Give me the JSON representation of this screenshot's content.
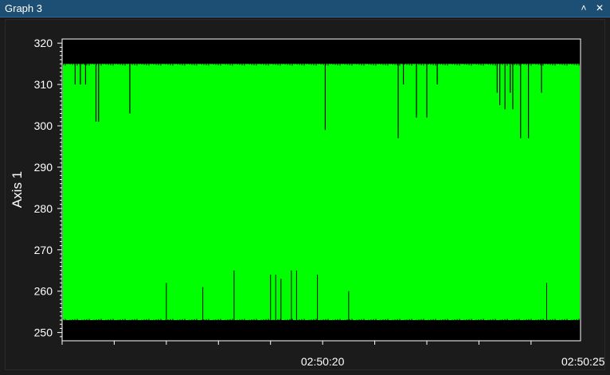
{
  "window": {
    "title": "Graph 3",
    "collapse_icon": "chevron-up-icon",
    "close_icon": "close-icon",
    "collapse_glyph": "˄",
    "close_glyph": "✕"
  },
  "chart_data": {
    "type": "area",
    "ylabel": "Axis 1",
    "xlabel": "",
    "ylim": [
      248,
      321
    ],
    "y_ticks": [
      250,
      260,
      270,
      280,
      290,
      300,
      310,
      320
    ],
    "y_tick_labels": [
      "250",
      "260",
      "270",
      "280",
      "290",
      "300",
      "310",
      "320"
    ],
    "x_tick_labels": [
      "02:50:20",
      "02:50:25"
    ],
    "x_tick_times_sec": [
      20,
      25
    ],
    "xlim_sec": [
      15.0,
      24.95
    ],
    "grid": false,
    "legend": "none",
    "colors": {
      "signal": "#00ff00",
      "background": "#000000",
      "frame": "#ffffff"
    },
    "series": [
      {
        "band_low": 253,
        "band_high": 315,
        "dips_from_top": [
          [
            15.25,
            310
          ],
          [
            15.35,
            310
          ],
          [
            15.45,
            310
          ],
          [
            15.65,
            301
          ],
          [
            15.7,
            301
          ],
          [
            16.3,
            303
          ],
          [
            20.05,
            299
          ],
          [
            21.45,
            297
          ],
          [
            21.55,
            310
          ],
          [
            21.8,
            302
          ],
          [
            22.0,
            302
          ],
          [
            22.2,
            310
          ],
          [
            23.35,
            308
          ],
          [
            23.4,
            305
          ],
          [
            23.5,
            304
          ],
          [
            23.6,
            308
          ],
          [
            23.65,
            304
          ],
          [
            23.8,
            297
          ],
          [
            23.95,
            297
          ],
          [
            24.2,
            308
          ]
        ],
        "spikes_from_bottom": [
          [
            17.0,
            262
          ],
          [
            17.7,
            261
          ],
          [
            18.3,
            265
          ],
          [
            19.0,
            264
          ],
          [
            19.1,
            264
          ],
          [
            19.2,
            263
          ],
          [
            19.4,
            265
          ],
          [
            19.5,
            265
          ],
          [
            19.9,
            264
          ],
          [
            20.5,
            260
          ],
          [
            24.3,
            262
          ]
        ]
      }
    ]
  }
}
